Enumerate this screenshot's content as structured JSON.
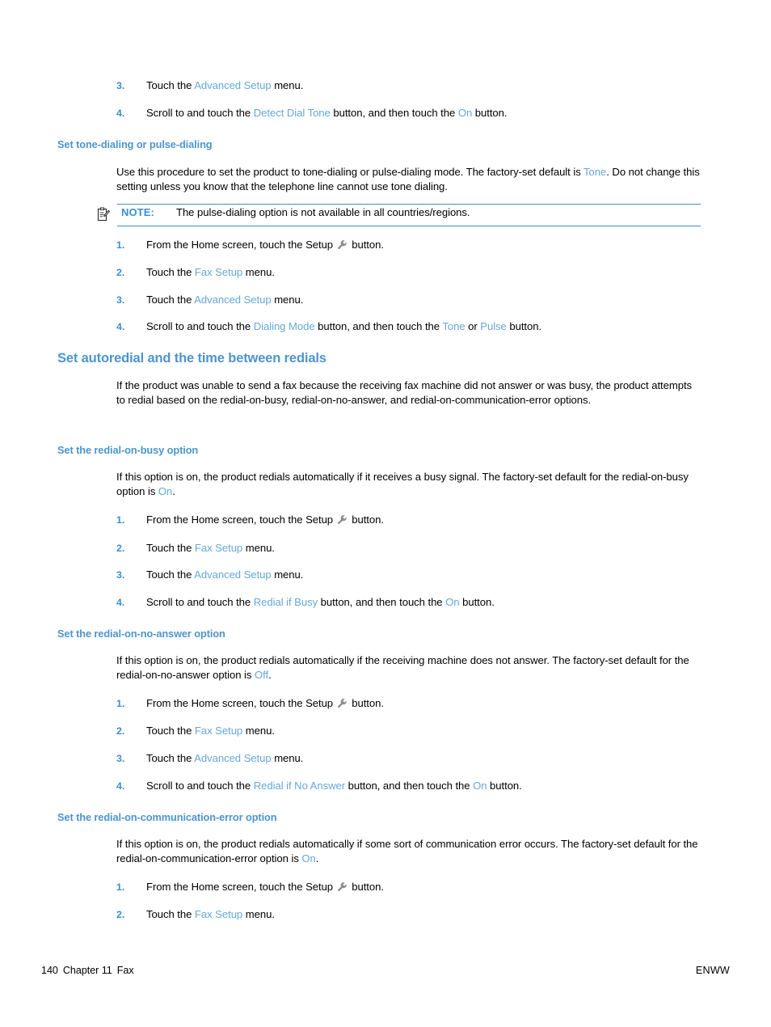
{
  "page": {
    "number": "140",
    "chapter": "Chapter 11",
    "chapter_topic": "Fax",
    "footer_right": "ENWW",
    "heading_color": "#4d95cd",
    "ui_term_color": "#66a8d8",
    "rule_color": "#3f8fcc"
  },
  "blocks": {
    "list_top": {
      "item3": {
        "num": "3.",
        "pre": "Touch the ",
        "ui1": "Advanced Setup",
        "post": " menu."
      },
      "item4": {
        "num": "4.",
        "pre": "Scroll to and touch the ",
        "ui1": "Detect Dial Tone",
        "mid": " button, and then touch the ",
        "ui2": "On",
        "post": " button."
      }
    },
    "tone_pulse": {
      "heading": "Set tone-dialing or pulse-dialing",
      "para": {
        "pre": "Use this procedure to set the product to tone-dialing or pulse-dialing mode. The factory-set default is ",
        "ui1": "Tone",
        "post": ". Do not change this setting unless you know that the telephone line cannot use tone dialing."
      },
      "note": {
        "icon": "note-clipboard-icon",
        "label": "NOTE:",
        "text": "The pulse-dialing option is not available in all countries/regions."
      },
      "steps": [
        {
          "num": "1.",
          "pre": "From the Home screen, touch the Setup ",
          "icon": "wrench-icon",
          "post": " button."
        },
        {
          "num": "2.",
          "pre": "Touch the ",
          "ui1": "Fax Setup",
          "post": " menu."
        },
        {
          "num": "3.",
          "pre": "Touch the ",
          "ui1": "Advanced Setup",
          "post": " menu."
        },
        {
          "num": "4.",
          "pre": "Scroll to and touch the ",
          "ui1": "Dialing Mode",
          "mid": " button, and then touch the ",
          "ui2": "Tone",
          "mid2": " or ",
          "ui3": "Pulse",
          "post": " button."
        }
      ]
    },
    "autoredial": {
      "heading": "Set autoredial and the time between redials",
      "para": "If the product was unable to send a fax because the receiving fax machine did not answer or was busy, the product attempts to redial based on the redial-on-busy, redial-on-no-answer, and redial-on-communication-error options."
    },
    "redial_busy": {
      "heading": "Set the redial-on-busy option",
      "para": {
        "pre": "If this option is on, the product redials automatically if it receives a busy signal. The factory-set default for the redial-on-busy option is ",
        "ui1": "On",
        "post": "."
      },
      "steps": [
        {
          "num": "1.",
          "pre": "From the Home screen, touch the Setup ",
          "icon": "wrench-icon",
          "post": " button."
        },
        {
          "num": "2.",
          "pre": "Touch the ",
          "ui1": "Fax Setup",
          "post": " menu."
        },
        {
          "num": "3.",
          "pre": "Touch the ",
          "ui1": "Advanced Setup",
          "post": " menu."
        },
        {
          "num": "4.",
          "pre": "Scroll to and touch the ",
          "ui1": "Redial if Busy",
          "mid": " button, and then touch the ",
          "ui2": "On",
          "post": " button."
        }
      ]
    },
    "redial_no_answer": {
      "heading": "Set the redial-on-no-answer option",
      "para": {
        "pre": "If this option is on, the product redials automatically if the receiving machine does not answer. The factory-set default for the redial-on-no-answer option is ",
        "ui1": "Off",
        "post": "."
      },
      "steps": [
        {
          "num": "1.",
          "pre": "From the Home screen, touch the Setup ",
          "icon": "wrench-icon",
          "post": " button."
        },
        {
          "num": "2.",
          "pre": "Touch the ",
          "ui1": "Fax Setup",
          "post": " menu."
        },
        {
          "num": "3.",
          "pre": "Touch the ",
          "ui1": "Advanced Setup",
          "post": " menu."
        },
        {
          "num": "4.",
          "pre": "Scroll to and touch the ",
          "ui1": "Redial if No Answer",
          "mid": " button, and then touch the ",
          "ui2": "On",
          "post": " button."
        }
      ]
    },
    "redial_comm_error": {
      "heading": "Set the redial-on-communication-error option",
      "para": {
        "pre": "If this option is on, the product redials automatically if some sort of communication error occurs. The factory-set default for the redial-on-communication-error option is ",
        "ui1": "On",
        "post": "."
      },
      "steps": [
        {
          "num": "1.",
          "pre": "From the Home screen, touch the Setup ",
          "icon": "wrench-icon",
          "post": " button."
        },
        {
          "num": "2.",
          "pre": "Touch the ",
          "ui1": "Fax Setup",
          "post": " menu."
        }
      ]
    }
  }
}
